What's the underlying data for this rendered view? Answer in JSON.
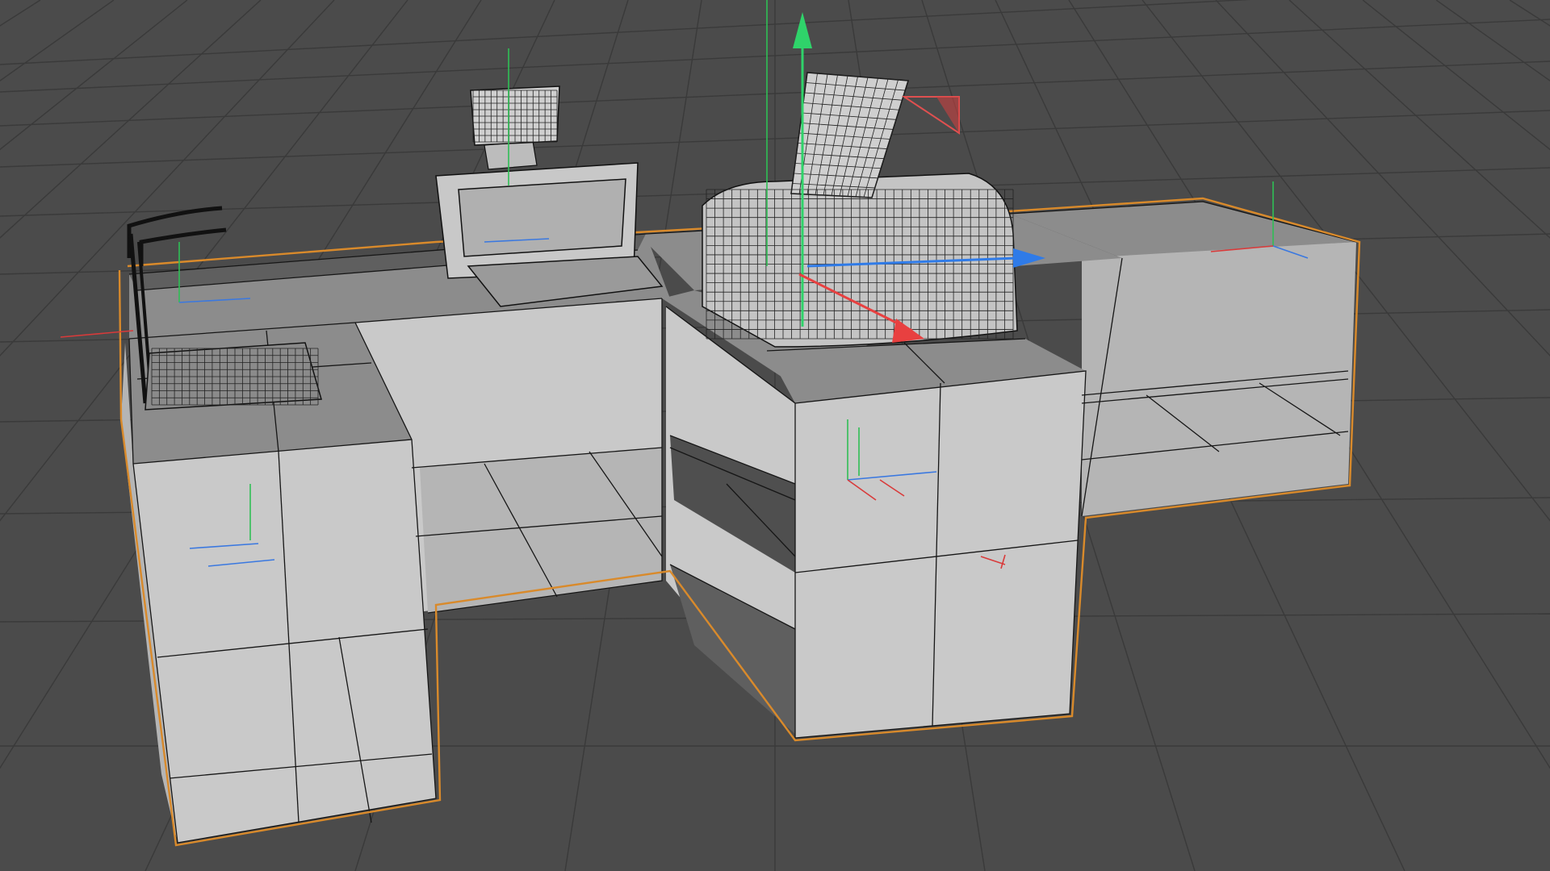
{
  "viewport": {
    "background": "#4b4b4b",
    "grid_color": "#3a3a3a",
    "selection_outline_color": "#d98a2b"
  },
  "objects": [
    {
      "name": "checkout-counter",
      "selected": true
    },
    {
      "name": "bag-rail",
      "selected": true
    },
    {
      "name": "scale-pad",
      "selected": true
    },
    {
      "name": "pos-terminal",
      "selected": true
    },
    {
      "name": "receipt-printer-station",
      "selected": true
    }
  ],
  "gizmo": {
    "x_color": "#e84040",
    "y_color": "#2fd36a",
    "z_color": "#2f7be8",
    "plane_color": "#e05050"
  }
}
